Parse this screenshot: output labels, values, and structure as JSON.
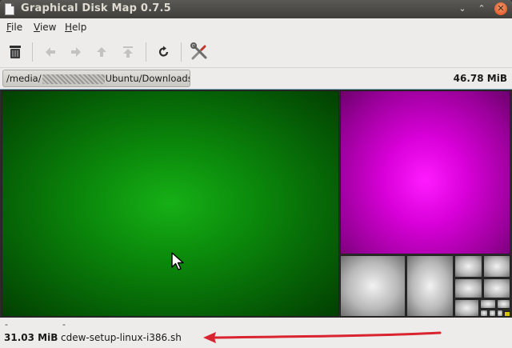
{
  "window": {
    "title": "Graphical Disk Map 0.7.5",
    "controls": [
      "⌄",
      "⌃",
      "✕"
    ]
  },
  "menu": [
    {
      "label": "File",
      "mnemonic": "F",
      "rest": "ile"
    },
    {
      "label": "View",
      "mnemonic": "V",
      "rest": "iew"
    },
    {
      "label": "Help",
      "mnemonic": "H",
      "rest": "elp"
    }
  ],
  "toolbar": {
    "icons": [
      "trash-icon",
      "back-icon",
      "forward-icon",
      "up-icon",
      "top-icon",
      "refresh-icon",
      "preferences-icon"
    ],
    "disabled": [
      "back-icon",
      "forward-icon",
      "up-icon",
      "top-icon"
    ]
  },
  "pathbar": {
    "path_prefix": "/media/",
    "path_suffix": "Ubuntu/Downloads",
    "total_size": "46.78 MiB"
  },
  "treemap": {
    "colors": {
      "green": "#0b8a0b",
      "magenta": "#d800d8",
      "gray": "#b9b9b9"
    }
  },
  "status": {
    "dash_left": "-",
    "dash_right": "-",
    "size": "31.03 MiB",
    "filename": "cdew-setup-linux-i386.sh"
  },
  "annotation": {
    "arrow_color": "#d9232e"
  }
}
